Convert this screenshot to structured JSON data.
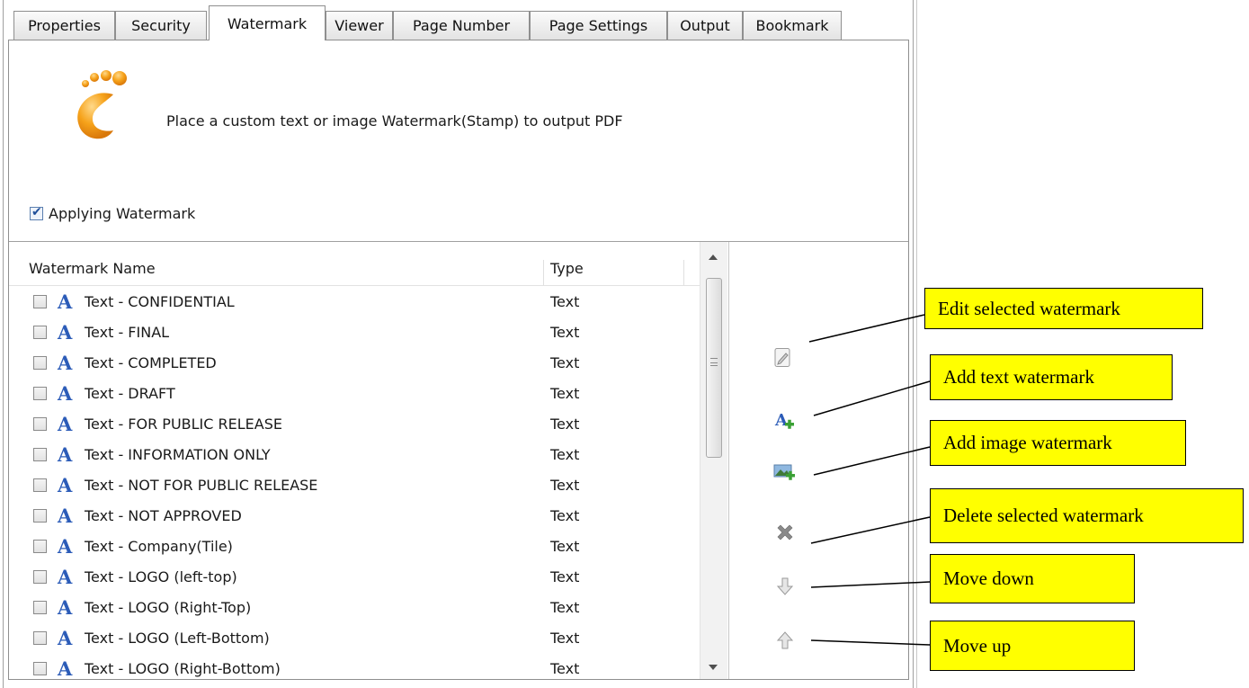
{
  "tabs": [
    {
      "label": "Properties",
      "active": false
    },
    {
      "label": "Security",
      "active": false
    },
    {
      "label": "Watermark",
      "active": true
    },
    {
      "label": "Viewer",
      "active": false
    },
    {
      "label": "Page Number",
      "active": false
    },
    {
      "label": "Page Settings",
      "active": false
    },
    {
      "label": "Output",
      "active": false
    },
    {
      "label": "Bookmark",
      "active": false
    }
  ],
  "header": {
    "logo_icon": "footprint-logo-icon",
    "description": "Place a custom text or image Watermark(Stamp) to output PDF"
  },
  "apply": {
    "label": "Applying Watermark",
    "checked": true
  },
  "table": {
    "columns": [
      "Watermark Name",
      "Type"
    ],
    "rows": [
      {
        "name": "Text - CONFIDENTIAL",
        "type": "Text"
      },
      {
        "name": "Text - FINAL",
        "type": "Text"
      },
      {
        "name": "Text - COMPLETED",
        "type": "Text"
      },
      {
        "name": "Text - DRAFT",
        "type": "Text"
      },
      {
        "name": "Text - FOR PUBLIC RELEASE",
        "type": "Text"
      },
      {
        "name": "Text - INFORMATION ONLY",
        "type": "Text"
      },
      {
        "name": "Text - NOT FOR PUBLIC RELEASE",
        "type": "Text"
      },
      {
        "name": "Text - NOT APPROVED",
        "type": "Text"
      },
      {
        "name": "Text - Company(Tile)",
        "type": "Text"
      },
      {
        "name": "Text - LOGO (left-top)",
        "type": "Text"
      },
      {
        "name": "Text - LOGO (Right-Top)",
        "type": "Text"
      },
      {
        "name": "Text - LOGO (Left-Bottom)",
        "type": "Text"
      },
      {
        "name": "Text - LOGO (Right-Bottom)",
        "type": "Text"
      }
    ]
  },
  "toolbar": [
    {
      "icon": "edit-icon",
      "callout": "Edit selected watermark"
    },
    {
      "icon": "add-text-icon",
      "callout": "Add text watermark"
    },
    {
      "icon": "add-image-icon",
      "callout": "Add image watermark"
    },
    {
      "icon": "delete-icon",
      "callout": "Delete selected watermark"
    },
    {
      "icon": "arrow-down-icon",
      "callout": "Move down"
    },
    {
      "icon": "arrow-up-icon",
      "callout": "Move up"
    }
  ],
  "colors": {
    "callout_bg": "#ffff00",
    "text_icon": "#2c5cb8"
  }
}
